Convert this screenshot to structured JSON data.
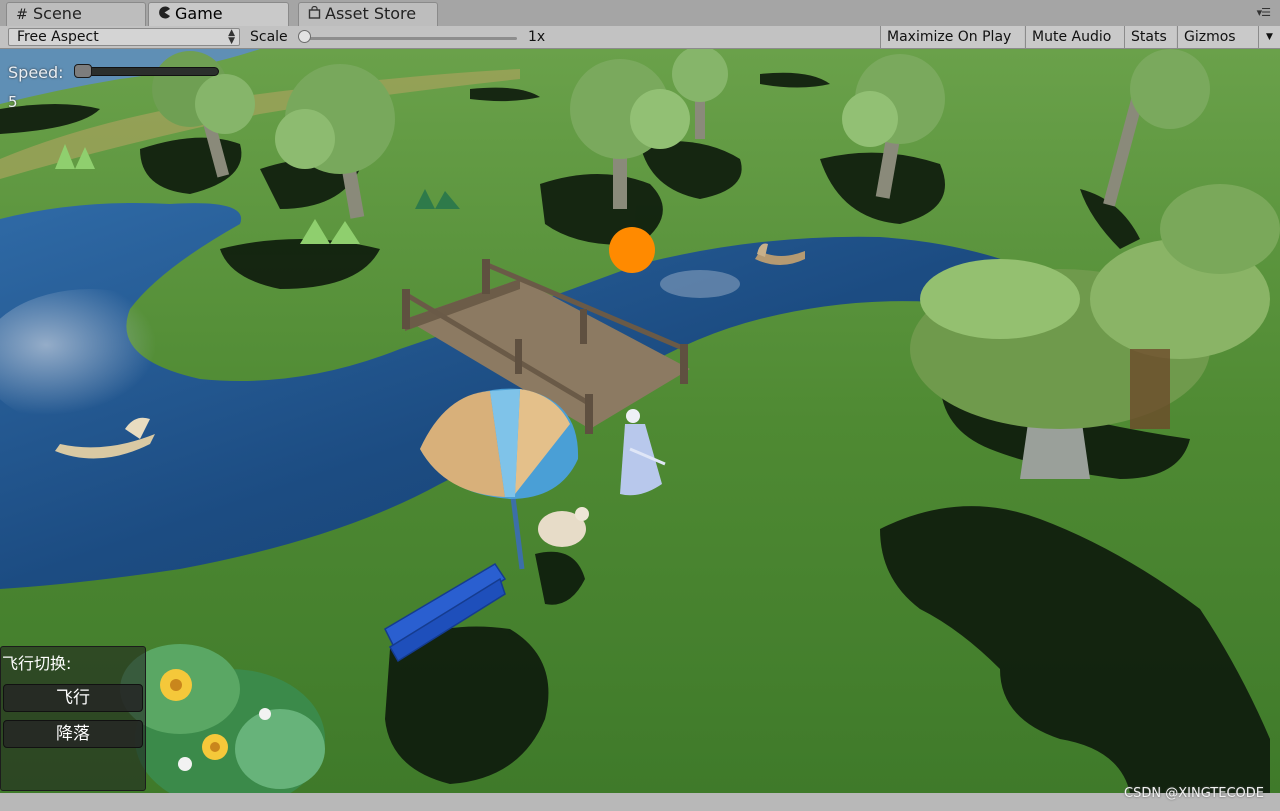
{
  "tabs": [
    {
      "label": "Scene",
      "icon": "grid-hash-icon",
      "active": false
    },
    {
      "label": "Game",
      "icon": "pacman-icon",
      "active": true
    },
    {
      "label": "Asset Store",
      "icon": "shopping-bag-icon",
      "active": false
    }
  ],
  "toolbar": {
    "aspect": "Free Aspect",
    "scale_label": "Scale",
    "scale_value": "1x",
    "maximize": "Maximize On Play",
    "mute": "Mute Audio",
    "stats": "Stats",
    "gizmos": "Gizmos"
  },
  "game_gui": {
    "speed_label": "Speed:",
    "speed_value": "5",
    "flight_title": "飞行切换:",
    "fly_button": "飞行",
    "land_button": "降落"
  },
  "watermark": "CSDN @XINGTECODE",
  "colors": {
    "grass": "#4f8a33",
    "water": "#1e4f86",
    "orange_marker": "#ff8a00",
    "umbrella_blue": "#4a9fd6",
    "umbrella_tan": "#d8b07a",
    "bench": "#2a5fd0"
  }
}
